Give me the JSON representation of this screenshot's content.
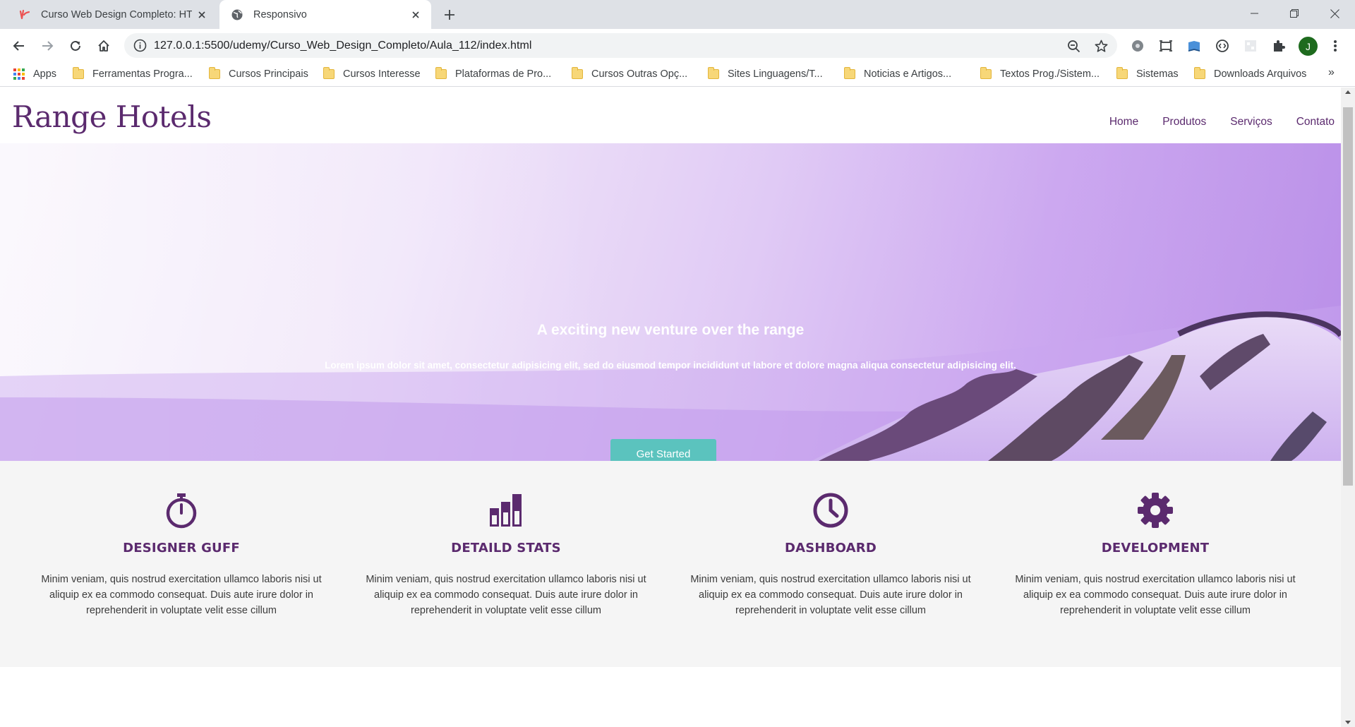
{
  "browser": {
    "tabs": [
      {
        "title": "Curso Web Design Completo: HT",
        "active": false
      },
      {
        "title": "Responsivo",
        "active": true
      }
    ],
    "url": "127.0.0.1:5500/udemy/Curso_Web_Design_Completo/Aula_112/index.html",
    "profile_initial": "J",
    "bookmarks": [
      "Apps",
      "Ferramentas Progra...",
      "Cursos Principais",
      "Cursos Interesse",
      "Plataformas de Pro...",
      "Cursos Outras Opç...",
      "Sites Linguagens/T...",
      "Noticias e Artigos...",
      "Textos Prog./Sistem...",
      "Sistemas",
      "Downloads Arquivos"
    ],
    "bookmarks_more": "»",
    "colors": {
      "tab_strip": "#dee1e6",
      "omnibox": "#f1f3f4",
      "avatar": "#1e6b1e"
    }
  },
  "site": {
    "logo": "Range Hotels",
    "nav": [
      "Home",
      "Produtos",
      "Serviços",
      "Contato"
    ],
    "hero": {
      "title": "A exciting new venture over the range",
      "text": "Lorem ipsum dolor sit amet, consectetur adipisicing elit, sed do eiusmod tempor incididunt ut labore et dolore magna aliqua consectetur adipisicing elit.",
      "button": "Get Started"
    },
    "features": [
      {
        "icon": "stopwatch-icon",
        "title": "Designer Guff",
        "text": "Minim veniam, quis nostrud exercitation ullamco laboris nisi ut aliquip ex ea commodo consequat. Duis aute irure dolor in reprehenderit in voluptate velit esse cillum"
      },
      {
        "icon": "bar-chart-icon",
        "title": "Detaild Stats",
        "text": "Minim veniam, quis nostrud exercitation ullamco laboris nisi ut aliquip ex ea commodo consequat. Duis aute irure dolor in reprehenderit in voluptate velit esse cillum"
      },
      {
        "icon": "clock-icon",
        "title": "Dashboard",
        "text": "Minim veniam, quis nostrud exercitation ullamco laboris nisi ut aliquip ex ea commodo consequat. Duis aute irure dolor in reprehenderit in voluptate velit esse cillum"
      },
      {
        "icon": "gear-icon",
        "title": "Development",
        "text": "Minim veniam, quis nostrud exercitation ullamco laboris nisi ut aliquip ex ea commodo consequat. Duis aute irure dolor in reprehenderit in voluptate velit esse cillum"
      }
    ],
    "colors": {
      "brand": "#5b2a6e",
      "button": "#5bc3be",
      "features_bg": "#f5f5f5"
    }
  }
}
